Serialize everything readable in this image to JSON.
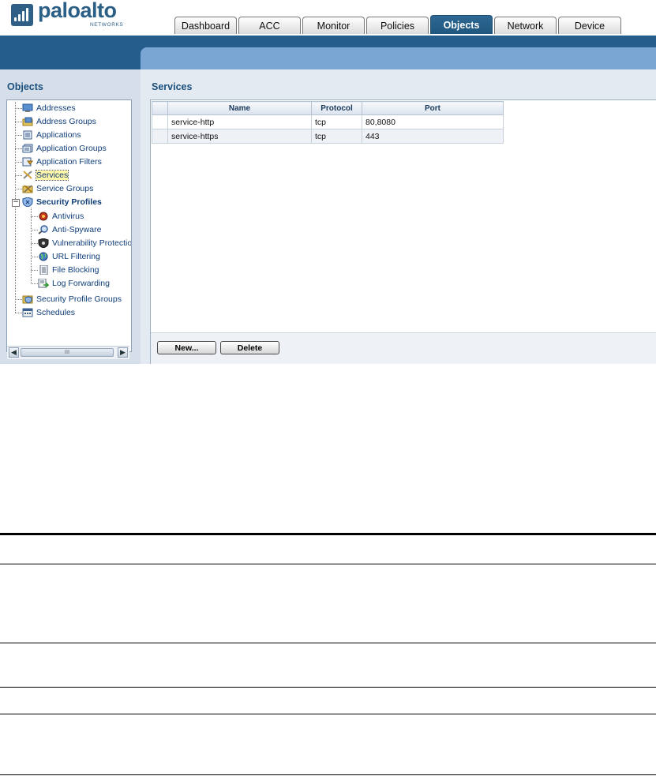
{
  "brand": {
    "logo_text": "paloalto",
    "logo_sub": "NETWORKS",
    "color_primary": "#255d8d",
    "color_light": "#7aa6d4"
  },
  "tabs": [
    {
      "label": "Dashboard",
      "active": false
    },
    {
      "label": "ACC",
      "active": false
    },
    {
      "label": "Monitor",
      "active": false
    },
    {
      "label": "Policies",
      "active": false
    },
    {
      "label": "Objects",
      "active": true
    },
    {
      "label": "Network",
      "active": false
    },
    {
      "label": "Device",
      "active": false
    }
  ],
  "sidebar": {
    "title": "Objects",
    "items": [
      {
        "label": "Addresses",
        "icon": "network-address-icon",
        "level": 0
      },
      {
        "label": "Address Groups",
        "icon": "address-group-icon",
        "level": 0
      },
      {
        "label": "Applications",
        "icon": "applications-icon",
        "level": 0
      },
      {
        "label": "Application Groups",
        "icon": "application-groups-icon",
        "level": 0
      },
      {
        "label": "Application Filters",
        "icon": "application-filters-icon",
        "level": 0
      },
      {
        "label": "Services",
        "icon": "tools-icon",
        "level": 0,
        "selected": true
      },
      {
        "label": "Service Groups",
        "icon": "service-groups-icon",
        "level": 0
      },
      {
        "label": "Security Profiles",
        "icon": "shield-icon",
        "level": 0,
        "bold": true,
        "expanded": true
      },
      {
        "label": "Antivirus",
        "icon": "antivirus-icon",
        "level": 1
      },
      {
        "label": "Anti-Spyware",
        "icon": "magnifier-icon",
        "level": 1
      },
      {
        "label": "Vulnerability Protection",
        "icon": "vulnerability-icon",
        "level": 1
      },
      {
        "label": "URL Filtering",
        "icon": "globe-icon",
        "level": 1
      },
      {
        "label": "File Blocking",
        "icon": "document-icon",
        "level": 1
      },
      {
        "label": "Log Forwarding",
        "icon": "log-forward-icon",
        "level": 1
      },
      {
        "label": "Security Profile Groups",
        "icon": "folder-shield-icon",
        "level": 0
      },
      {
        "label": "Schedules",
        "icon": "calendar-icon",
        "level": 0
      }
    ],
    "scrollbar_grip": "III"
  },
  "main": {
    "title": "Services",
    "columns": [
      "Name",
      "Protocol",
      "Port"
    ],
    "rows": [
      {
        "name": "service-http",
        "protocol": "tcp",
        "port": "80,8080"
      },
      {
        "name": "service-https",
        "protocol": "tcp",
        "port": "443"
      }
    ],
    "buttons": {
      "new_label": "New...",
      "delete_label": "Delete"
    }
  }
}
